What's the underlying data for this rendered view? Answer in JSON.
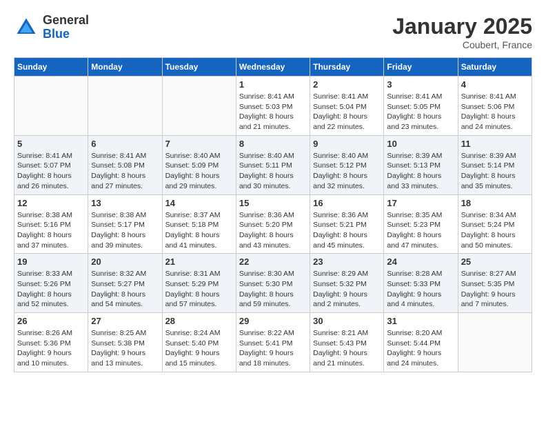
{
  "logo": {
    "general": "General",
    "blue": "Blue"
  },
  "title": "January 2025",
  "subtitle": "Coubert, France",
  "days_of_week": [
    "Sunday",
    "Monday",
    "Tuesday",
    "Wednesday",
    "Thursday",
    "Friday",
    "Saturday"
  ],
  "weeks": [
    [
      {
        "day": "",
        "info": ""
      },
      {
        "day": "",
        "info": ""
      },
      {
        "day": "",
        "info": ""
      },
      {
        "day": "1",
        "sunrise": "Sunrise: 8:41 AM",
        "sunset": "Sunset: 5:03 PM",
        "daylight": "Daylight: 8 hours and 21 minutes."
      },
      {
        "day": "2",
        "sunrise": "Sunrise: 8:41 AM",
        "sunset": "Sunset: 5:04 PM",
        "daylight": "Daylight: 8 hours and 22 minutes."
      },
      {
        "day": "3",
        "sunrise": "Sunrise: 8:41 AM",
        "sunset": "Sunset: 5:05 PM",
        "daylight": "Daylight: 8 hours and 23 minutes."
      },
      {
        "day": "4",
        "sunrise": "Sunrise: 8:41 AM",
        "sunset": "Sunset: 5:06 PM",
        "daylight": "Daylight: 8 hours and 24 minutes."
      }
    ],
    [
      {
        "day": "5",
        "sunrise": "Sunrise: 8:41 AM",
        "sunset": "Sunset: 5:07 PM",
        "daylight": "Daylight: 8 hours and 26 minutes."
      },
      {
        "day": "6",
        "sunrise": "Sunrise: 8:41 AM",
        "sunset": "Sunset: 5:08 PM",
        "daylight": "Daylight: 8 hours and 27 minutes."
      },
      {
        "day": "7",
        "sunrise": "Sunrise: 8:40 AM",
        "sunset": "Sunset: 5:09 PM",
        "daylight": "Daylight: 8 hours and 29 minutes."
      },
      {
        "day": "8",
        "sunrise": "Sunrise: 8:40 AM",
        "sunset": "Sunset: 5:11 PM",
        "daylight": "Daylight: 8 hours and 30 minutes."
      },
      {
        "day": "9",
        "sunrise": "Sunrise: 8:40 AM",
        "sunset": "Sunset: 5:12 PM",
        "daylight": "Daylight: 8 hours and 32 minutes."
      },
      {
        "day": "10",
        "sunrise": "Sunrise: 8:39 AM",
        "sunset": "Sunset: 5:13 PM",
        "daylight": "Daylight: 8 hours and 33 minutes."
      },
      {
        "day": "11",
        "sunrise": "Sunrise: 8:39 AM",
        "sunset": "Sunset: 5:14 PM",
        "daylight": "Daylight: 8 hours and 35 minutes."
      }
    ],
    [
      {
        "day": "12",
        "sunrise": "Sunrise: 8:38 AM",
        "sunset": "Sunset: 5:16 PM",
        "daylight": "Daylight: 8 hours and 37 minutes."
      },
      {
        "day": "13",
        "sunrise": "Sunrise: 8:38 AM",
        "sunset": "Sunset: 5:17 PM",
        "daylight": "Daylight: 8 hours and 39 minutes."
      },
      {
        "day": "14",
        "sunrise": "Sunrise: 8:37 AM",
        "sunset": "Sunset: 5:18 PM",
        "daylight": "Daylight: 8 hours and 41 minutes."
      },
      {
        "day": "15",
        "sunrise": "Sunrise: 8:36 AM",
        "sunset": "Sunset: 5:20 PM",
        "daylight": "Daylight: 8 hours and 43 minutes."
      },
      {
        "day": "16",
        "sunrise": "Sunrise: 8:36 AM",
        "sunset": "Sunset: 5:21 PM",
        "daylight": "Daylight: 8 hours and 45 minutes."
      },
      {
        "day": "17",
        "sunrise": "Sunrise: 8:35 AM",
        "sunset": "Sunset: 5:23 PM",
        "daylight": "Daylight: 8 hours and 47 minutes."
      },
      {
        "day": "18",
        "sunrise": "Sunrise: 8:34 AM",
        "sunset": "Sunset: 5:24 PM",
        "daylight": "Daylight: 8 hours and 50 minutes."
      }
    ],
    [
      {
        "day": "19",
        "sunrise": "Sunrise: 8:33 AM",
        "sunset": "Sunset: 5:26 PM",
        "daylight": "Daylight: 8 hours and 52 minutes."
      },
      {
        "day": "20",
        "sunrise": "Sunrise: 8:32 AM",
        "sunset": "Sunset: 5:27 PM",
        "daylight": "Daylight: 8 hours and 54 minutes."
      },
      {
        "day": "21",
        "sunrise": "Sunrise: 8:31 AM",
        "sunset": "Sunset: 5:29 PM",
        "daylight": "Daylight: 8 hours and 57 minutes."
      },
      {
        "day": "22",
        "sunrise": "Sunrise: 8:30 AM",
        "sunset": "Sunset: 5:30 PM",
        "daylight": "Daylight: 8 hours and 59 minutes."
      },
      {
        "day": "23",
        "sunrise": "Sunrise: 8:29 AM",
        "sunset": "Sunset: 5:32 PM",
        "daylight": "Daylight: 9 hours and 2 minutes."
      },
      {
        "day": "24",
        "sunrise": "Sunrise: 8:28 AM",
        "sunset": "Sunset: 5:33 PM",
        "daylight": "Daylight: 9 hours and 4 minutes."
      },
      {
        "day": "25",
        "sunrise": "Sunrise: 8:27 AM",
        "sunset": "Sunset: 5:35 PM",
        "daylight": "Daylight: 9 hours and 7 minutes."
      }
    ],
    [
      {
        "day": "26",
        "sunrise": "Sunrise: 8:26 AM",
        "sunset": "Sunset: 5:36 PM",
        "daylight": "Daylight: 9 hours and 10 minutes."
      },
      {
        "day": "27",
        "sunrise": "Sunrise: 8:25 AM",
        "sunset": "Sunset: 5:38 PM",
        "daylight": "Daylight: 9 hours and 13 minutes."
      },
      {
        "day": "28",
        "sunrise": "Sunrise: 8:24 AM",
        "sunset": "Sunset: 5:40 PM",
        "daylight": "Daylight: 9 hours and 15 minutes."
      },
      {
        "day": "29",
        "sunrise": "Sunrise: 8:22 AM",
        "sunset": "Sunset: 5:41 PM",
        "daylight": "Daylight: 9 hours and 18 minutes."
      },
      {
        "day": "30",
        "sunrise": "Sunrise: 8:21 AM",
        "sunset": "Sunset: 5:43 PM",
        "daylight": "Daylight: 9 hours and 21 minutes."
      },
      {
        "day": "31",
        "sunrise": "Sunrise: 8:20 AM",
        "sunset": "Sunset: 5:44 PM",
        "daylight": "Daylight: 9 hours and 24 minutes."
      },
      {
        "day": "",
        "info": ""
      }
    ]
  ]
}
